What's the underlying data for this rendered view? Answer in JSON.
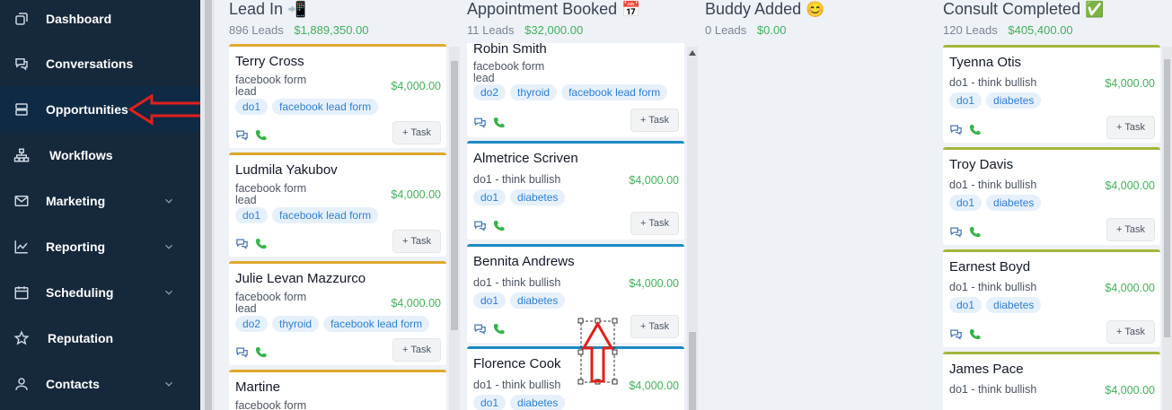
{
  "sidebar": {
    "items": [
      {
        "label": "Dashboard",
        "icon": "dashboard-icon",
        "chevron": false,
        "active": false
      },
      {
        "label": "Conversations",
        "icon": "chat-icon",
        "chevron": false,
        "active": false
      },
      {
        "label": "Opportunities",
        "icon": "opportunities-icon",
        "chevron": false,
        "active": true
      },
      {
        "label": "Workflows",
        "icon": "workflow-icon",
        "chevron": false,
        "active": false
      },
      {
        "label": "Marketing",
        "icon": "mail-icon",
        "chevron": true,
        "active": false
      },
      {
        "label": "Reporting",
        "icon": "chart-icon",
        "chevron": true,
        "active": false
      },
      {
        "label": "Scheduling",
        "icon": "calendar-icon",
        "chevron": true,
        "active": false
      },
      {
        "label": "Reputation",
        "icon": "star-icon",
        "chevron": false,
        "active": false
      },
      {
        "label": "Contacts",
        "icon": "user-icon",
        "chevron": true,
        "active": false
      }
    ]
  },
  "pipeline": {
    "columns": [
      {
        "title": "Lead In",
        "emoji": "📲",
        "count": "896 Leads",
        "amount": "$1,889,350.00",
        "cards": [
          {
            "name": "Terry Cross",
            "source_line1": "facebook form",
            "source_line2": "lead",
            "value": "$4,000.00",
            "tags": [
              "do1",
              "facebook lead form"
            ],
            "task": "+ Task"
          },
          {
            "name": "Ludmila Yakubov",
            "source_line1": "facebook form",
            "source_line2": "lead",
            "value": "$4,000.00",
            "tags": [
              "do1",
              "facebook lead form"
            ],
            "task": "+ Task"
          },
          {
            "name": "Julie Levan Mazzurco",
            "source_line1": "facebook form",
            "source_line2": "lead",
            "value": "$4,000.00",
            "tags": [
              "do2",
              "thyroid",
              "facebook lead form"
            ],
            "task": "+ Task"
          },
          {
            "name": "Martine",
            "source_line1": "facebook form",
            "source_line2": "",
            "value": "",
            "tags": [],
            "task": ""
          }
        ]
      },
      {
        "title": "Appointment Booked",
        "emoji": "📅",
        "count": "11 Leads",
        "amount": "$32,000.00",
        "cards": [
          {
            "name": "Robin Smith",
            "source_line1": "facebook form",
            "source_line2": "lead",
            "value": "",
            "tags": [
              "do2",
              "thyroid",
              "facebook lead form"
            ],
            "task": "+ Task"
          },
          {
            "name": "Almetrice Scriven",
            "source_line1": "do1 - think bullish",
            "source_line2": "",
            "value": "$4,000.00",
            "tags": [
              "do1",
              "diabetes"
            ],
            "task": "+ Task"
          },
          {
            "name": "Bennita Andrews",
            "source_line1": "do1 - think bullish",
            "source_line2": "",
            "value": "$4,000.00",
            "tags": [
              "do1",
              "diabetes"
            ],
            "task": "+ Task"
          },
          {
            "name": "Florence Cook",
            "source_line1": "do1 - think bullish",
            "source_line2": "",
            "value": "$4,000.00",
            "tags": [
              "do1",
              "diabetes"
            ],
            "task": ""
          }
        ]
      },
      {
        "title": "Buddy Added",
        "emoji": "😊",
        "count": "0 Leads",
        "amount": "$0.00",
        "cards": []
      },
      {
        "title": "Consult Completed",
        "emoji": "✅",
        "count": "120 Leads",
        "amount": "$405,400.00",
        "cards": [
          {
            "name": "Tyenna Otis",
            "source_line1": "do1 - think bullish",
            "source_line2": "",
            "value": "$4,000.00",
            "tags": [
              "do1",
              "diabetes"
            ],
            "task": "+ Task"
          },
          {
            "name": "Troy Davis",
            "source_line1": "do1 - think bullish",
            "source_line2": "",
            "value": "$4,000.00",
            "tags": [
              "do1",
              "diabetes"
            ],
            "task": "+ Task"
          },
          {
            "name": "Earnest Boyd",
            "source_line1": "do1 - think bullish",
            "source_line2": "",
            "value": "$4,000.00",
            "tags": [
              "do1",
              "diabetes"
            ],
            "task": "+ Task"
          },
          {
            "name": "James Pace",
            "source_line1": "do1 - think bullish",
            "source_line2": "",
            "value": "$4,000.00",
            "tags": [],
            "task": ""
          }
        ]
      }
    ]
  },
  "colors": {
    "sidebar_bg": "#16283b",
    "active_bg": "#0f2a45",
    "amount_green": "#43b05c",
    "tag_blue": "#2f80d1",
    "annotation_red": "#e0201b"
  }
}
